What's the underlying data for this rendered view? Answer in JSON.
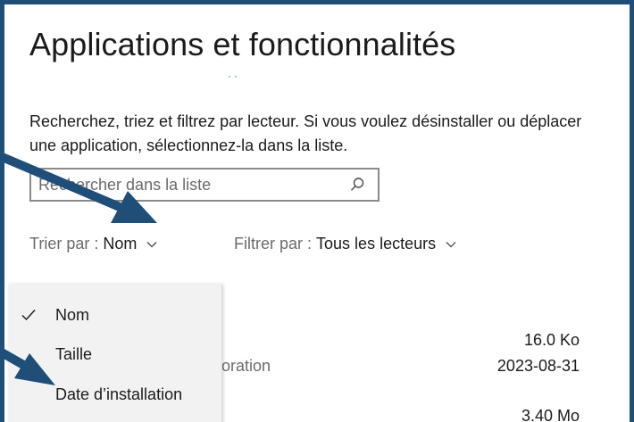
{
  "page": {
    "title": "Applications et fonctionnalités",
    "description": "Recherchez, triez et filtrez par lecteur. Si vous voulez désinstaller ou déplacer une application, sélectionnez-la dans la liste."
  },
  "search": {
    "placeholder": "Rechercher dans la liste",
    "value": ""
  },
  "sort": {
    "label": "Trier par :",
    "value": "Nom"
  },
  "filter": {
    "label": "Filtrer par :",
    "value": "Tous les lecteurs"
  },
  "sort_menu": {
    "items": [
      {
        "label": "Nom",
        "checked": true
      },
      {
        "label": "Taille",
        "checked": false
      },
      {
        "label": "Date d’installation",
        "checked": false
      }
    ]
  },
  "apps": [
    {
      "publisher_fragment": "oration",
      "size": "16.0 Ko",
      "date": "2023-08-31"
    },
    {
      "size": "3.40 Mo"
    }
  ],
  "colors": {
    "frame_border": "#1f4e79",
    "annotation_arrow": "#1f4e79",
    "accent": "#0078d4"
  },
  "icons": {
    "search": "search-icon",
    "chevron": "chevron-down-icon",
    "check": "checkmark-icon"
  }
}
